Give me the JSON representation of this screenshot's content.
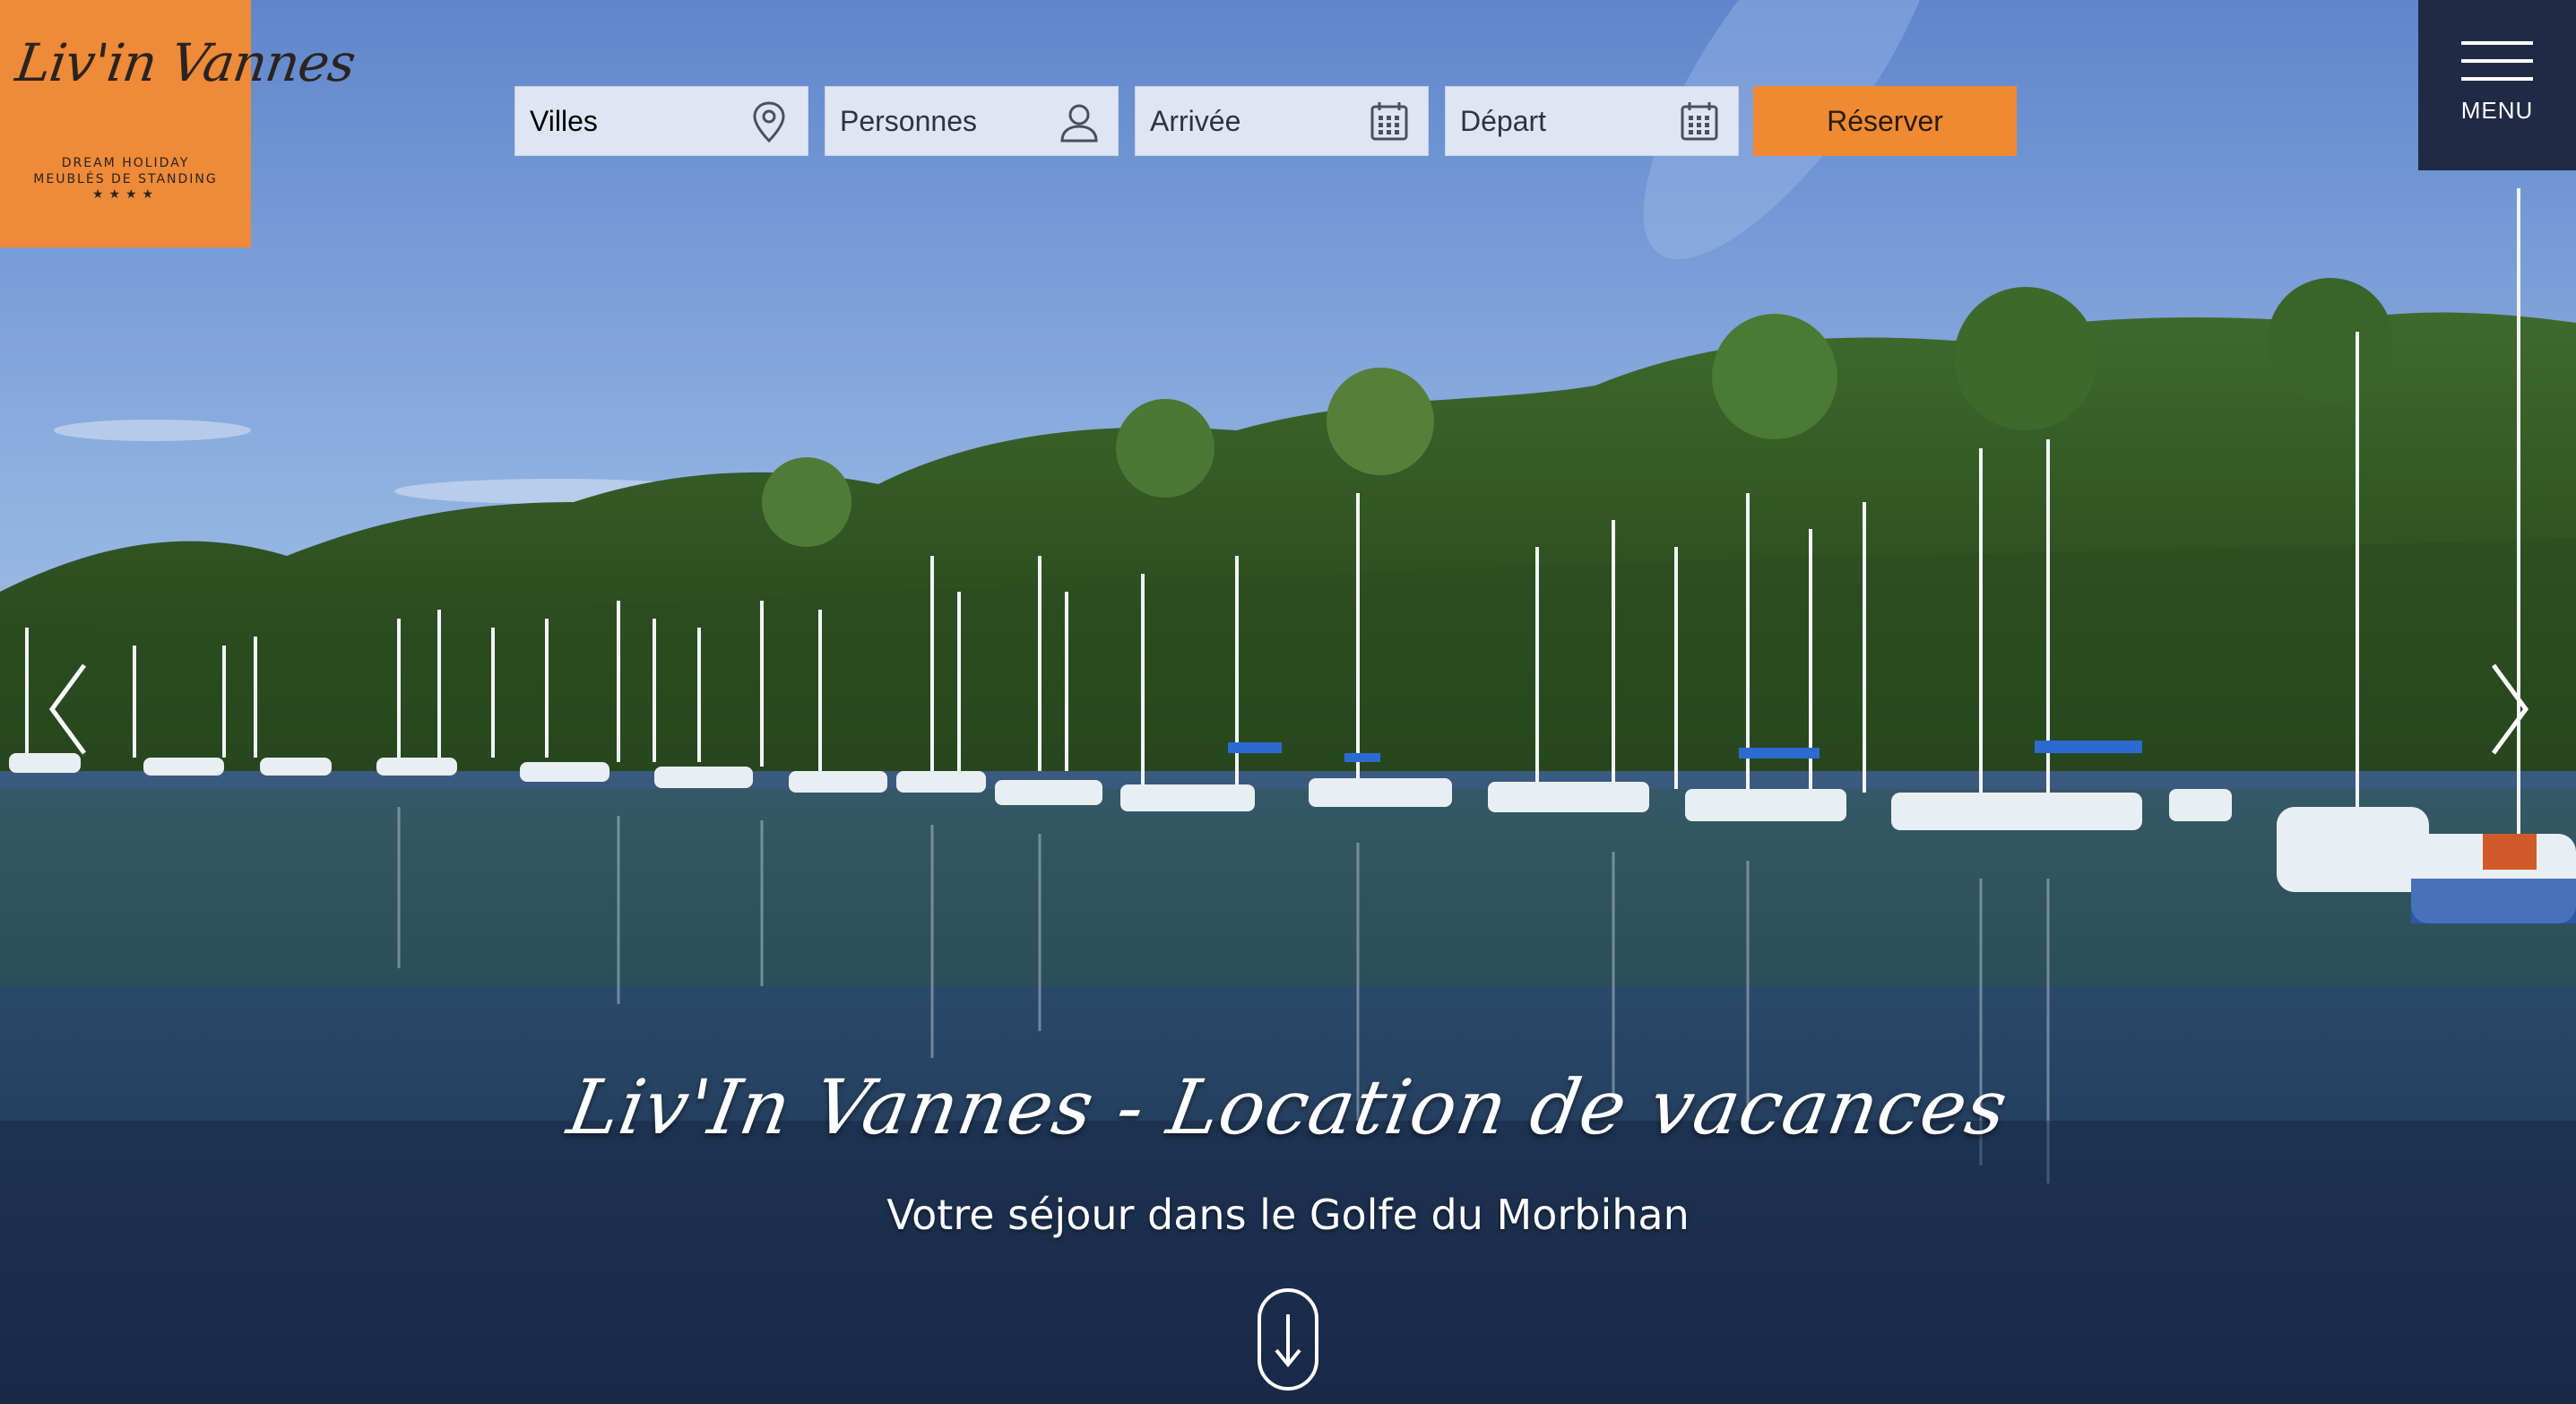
{
  "logo": {
    "script": "Liv'in Vannes",
    "tagline_1": "DREAM HOLIDAY",
    "tagline_2": "MEUBLÉS DE STANDING",
    "stars": "★★★★"
  },
  "booking": {
    "fields": [
      {
        "label": "Villes",
        "icon": "map-pin-icon"
      },
      {
        "label": "Personnes",
        "icon": "user-icon"
      },
      {
        "label": "Arrivée",
        "icon": "calendar-icon"
      },
      {
        "label": "Départ",
        "icon": "calendar-icon"
      }
    ],
    "reserve_label": "Réserver"
  },
  "menu": {
    "label": "MENU",
    "icon": "hamburger-icon"
  },
  "hero": {
    "title": "Liv'In Vannes - Location de vacances",
    "subtitle": "Votre séjour dans le Golfe du Morbihan",
    "prev_icon": "chevron-left-icon",
    "next_icon": "chevron-right-icon",
    "scroll_icon": "arrow-down-icon"
  },
  "colors": {
    "accent_orange": "#f08a32",
    "menu_navy": "#1f2b45",
    "field_bg": "#dfe6f2"
  }
}
